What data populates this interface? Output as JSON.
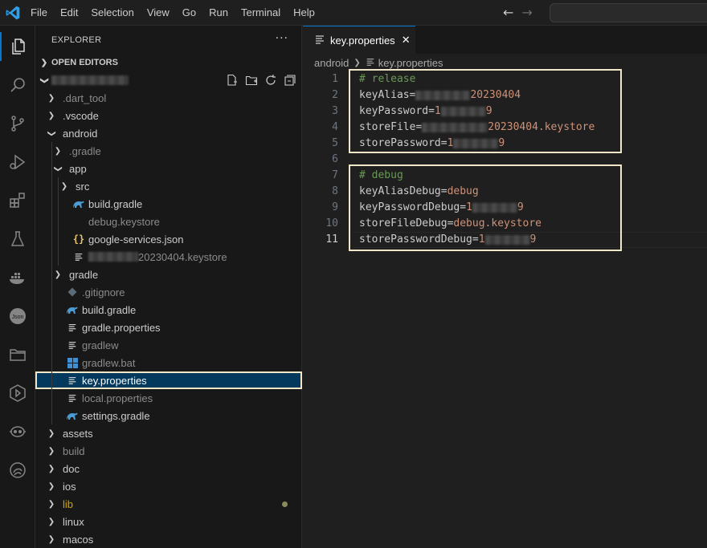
{
  "menu": [
    "File",
    "Edit",
    "Selection",
    "View",
    "Go",
    "Run",
    "Terminal",
    "Help"
  ],
  "explorer": {
    "title": "EXPLORER",
    "more": "···",
    "open_editors": "OPEN EDITORS"
  },
  "tree": [
    {
      "label": ".dart_tool",
      "indent": 1,
      "kind": "folder",
      "dim": true
    },
    {
      "label": ".vscode",
      "indent": 1,
      "kind": "folder"
    },
    {
      "label": "android",
      "indent": 1,
      "kind": "folder-open"
    },
    {
      "label": ".gradle",
      "indent": 2,
      "kind": "folder",
      "dim": true
    },
    {
      "label": "app",
      "indent": 2,
      "kind": "folder-open"
    },
    {
      "label": "src",
      "indent": 3,
      "kind": "folder"
    },
    {
      "label": "build.gradle",
      "indent": 3,
      "kind": "gradle"
    },
    {
      "label": "debug.keystore",
      "indent": 3,
      "kind": "none",
      "dim": true
    },
    {
      "label": "google-services.json",
      "indent": 3,
      "kind": "json"
    },
    {
      "label": "20230404.keystore",
      "indent": 3,
      "kind": "lines",
      "dim": true,
      "blurred_prefix": true
    },
    {
      "label": "gradle",
      "indent": 2,
      "kind": "folder"
    },
    {
      "label": ".gitignore",
      "indent": 2,
      "kind": "git",
      "dim": true
    },
    {
      "label": "build.gradle",
      "indent": 2,
      "kind": "gradle"
    },
    {
      "label": "gradle.properties",
      "indent": 2,
      "kind": "lines"
    },
    {
      "label": "gradlew",
      "indent": 2,
      "kind": "lines",
      "dim": true
    },
    {
      "label": "gradlew.bat",
      "indent": 2,
      "kind": "windows",
      "dim": true
    },
    {
      "label": "key.properties",
      "indent": 2,
      "kind": "lines",
      "selected": true
    },
    {
      "label": "local.properties",
      "indent": 2,
      "kind": "lines",
      "dim": true
    },
    {
      "label": "settings.gradle",
      "indent": 2,
      "kind": "gradle"
    },
    {
      "label": "assets",
      "indent": 1,
      "kind": "folder"
    },
    {
      "label": "build",
      "indent": 1,
      "kind": "folder",
      "dim": true
    },
    {
      "label": "doc",
      "indent": 1,
      "kind": "folder"
    },
    {
      "label": "ios",
      "indent": 1,
      "kind": "folder"
    },
    {
      "label": "lib",
      "indent": 1,
      "kind": "folder",
      "yellow": true,
      "modified": true
    },
    {
      "label": "linux",
      "indent": 1,
      "kind": "folder"
    },
    {
      "label": "macos",
      "indent": 1,
      "kind": "folder"
    }
  ],
  "tab": {
    "label": "key.properties",
    "close": "✕"
  },
  "breadcrumb": [
    "android",
    "key.properties"
  ],
  "code": [
    {
      "n": "1",
      "parts": [
        {
          "t": "# release",
          "c": "cm"
        }
      ]
    },
    {
      "n": "2",
      "parts": [
        {
          "t": "keyAlias=",
          "c": ""
        },
        {
          "t": "",
          "c": "blur",
          "w": 68
        },
        {
          "t": "20230404",
          "c": "str"
        }
      ]
    },
    {
      "n": "3",
      "parts": [
        {
          "t": "keyPassword=",
          "c": ""
        },
        {
          "t": "1",
          "c": "str"
        },
        {
          "t": "",
          "c": "blur",
          "w": 56
        },
        {
          "t": "9",
          "c": "str"
        }
      ]
    },
    {
      "n": "4",
      "parts": [
        {
          "t": "storeFile=",
          "c": ""
        },
        {
          "t": "",
          "c": "blur",
          "w": 82
        },
        {
          "t": "20230404.keystore",
          "c": "str"
        }
      ]
    },
    {
      "n": "5",
      "parts": [
        {
          "t": "storePassword=",
          "c": ""
        },
        {
          "t": "1",
          "c": "str"
        },
        {
          "t": "",
          "c": "blur",
          "w": 56
        },
        {
          "t": "9",
          "c": "str"
        }
      ]
    },
    {
      "n": "6",
      "parts": []
    },
    {
      "n": "7",
      "parts": [
        {
          "t": "# debug",
          "c": "cm"
        }
      ]
    },
    {
      "n": "8",
      "parts": [
        {
          "t": "keyAliasDebug=",
          "c": ""
        },
        {
          "t": "debug",
          "c": "str"
        }
      ]
    },
    {
      "n": "9",
      "parts": [
        {
          "t": "keyPasswordDebug=",
          "c": ""
        },
        {
          "t": "1",
          "c": "str"
        },
        {
          "t": "",
          "c": "blur",
          "w": 56
        },
        {
          "t": "9",
          "c": "str"
        }
      ]
    },
    {
      "n": "10",
      "parts": [
        {
          "t": "storeFileDebug=",
          "c": ""
        },
        {
          "t": "debug.keystore",
          "c": "str"
        }
      ]
    },
    {
      "n": "11",
      "parts": [
        {
          "t": "storePasswordDebug=",
          "c": ""
        },
        {
          "t": "1",
          "c": "str"
        },
        {
          "t": "",
          "c": "blur",
          "w": 56
        },
        {
          "t": "9",
          "c": "str"
        }
      ],
      "current": true
    }
  ],
  "colors": {
    "accent": "#0078d4",
    "highlight_box": "#f0e6c8",
    "comment": "#6a9955",
    "string": "#ce9178",
    "gradle_icon": "#4a9bd1",
    "json_icon": "#e8c46a"
  }
}
